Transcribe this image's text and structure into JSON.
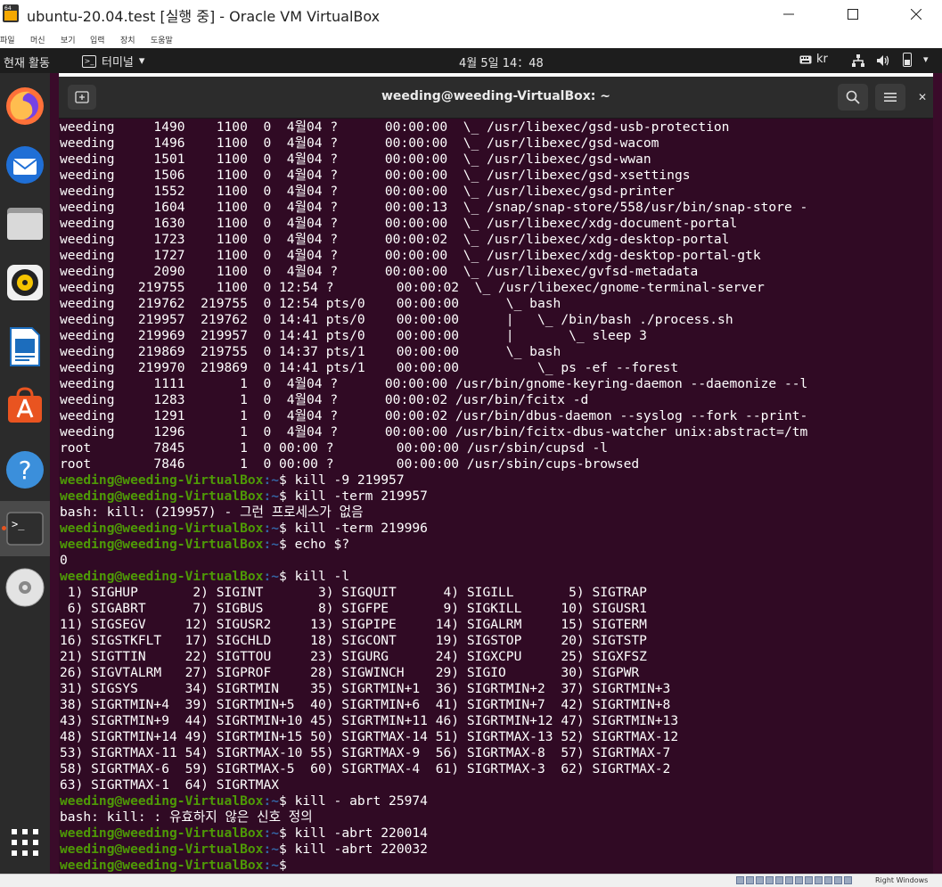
{
  "host": {
    "title": "ubuntu-20.04.test [실행 중] - Oracle VM VirtualBox",
    "menus": [
      "파일",
      "머신",
      "보기",
      "입력",
      "장치",
      "도움말"
    ],
    "host_key_label": "Right Windows"
  },
  "topbar": {
    "activities": "현재 활동",
    "app_name": "터미널",
    "clock": "4월 5일  14：48",
    "keyboard": "kr"
  },
  "dock": {
    "items": [
      "firefox-icon",
      "thunderbird-icon",
      "files-icon",
      "rhythmbox-icon",
      "writer-icon",
      "software-icon",
      "help-icon",
      "terminal-icon",
      "dvd-icon",
      "show-apps-icon"
    ]
  },
  "terminal": {
    "title": "weeding@weeding-VirtualBox: ~",
    "prompt_user": "weeding@weeding-VirtualBox",
    "prompt_path": ":~",
    "lines": [
      {
        "t": "weeding     1490    1100  0  4월04 ?      00:00:00  \\_ /usr/libexec/gsd-usb-protection"
      },
      {
        "t": "weeding     1496    1100  0  4월04 ?      00:00:00  \\_ /usr/libexec/gsd-wacom"
      },
      {
        "t": "weeding     1501    1100  0  4월04 ?      00:00:00  \\_ /usr/libexec/gsd-wwan"
      },
      {
        "t": "weeding     1506    1100  0  4월04 ?      00:00:00  \\_ /usr/libexec/gsd-xsettings"
      },
      {
        "t": "weeding     1552    1100  0  4월04 ?      00:00:00  \\_ /usr/libexec/gsd-printer"
      },
      {
        "t": "weeding     1604    1100  0  4월04 ?      00:00:13  \\_ /snap/snap-store/558/usr/bin/snap-store -"
      },
      {
        "t": "weeding     1630    1100  0  4월04 ?      00:00:00  \\_ /usr/libexec/xdg-document-portal"
      },
      {
        "t": "weeding     1723    1100  0  4월04 ?      00:00:02  \\_ /usr/libexec/xdg-desktop-portal"
      },
      {
        "t": "weeding     1727    1100  0  4월04 ?      00:00:00  \\_ /usr/libexec/xdg-desktop-portal-gtk"
      },
      {
        "t": "weeding     2090    1100  0  4월04 ?      00:00:00  \\_ /usr/libexec/gvfsd-metadata"
      },
      {
        "t": "weeding   219755    1100  0 12:54 ?        00:00:02  \\_ /usr/libexec/gnome-terminal-server"
      },
      {
        "t": "weeding   219762  219755  0 12:54 pts/0    00:00:00      \\_ bash"
      },
      {
        "t": "weeding   219957  219762  0 14:41 pts/0    00:00:00      |   \\_ /bin/bash ./process.sh"
      },
      {
        "t": "weeding   219969  219957  0 14:41 pts/0    00:00:00      |       \\_ sleep 3"
      },
      {
        "t": "weeding   219869  219755  0 14:37 pts/1    00:00:00      \\_ bash"
      },
      {
        "t": "weeding   219970  219869  0 14:41 pts/1    00:00:00          \\_ ps -ef --forest"
      },
      {
        "t": "weeding     1111       1  0  4월04 ?      00:00:00 /usr/bin/gnome-keyring-daemon --daemonize --l"
      },
      {
        "t": "weeding     1283       1  0  4월04 ?      00:00:02 /usr/bin/fcitx -d"
      },
      {
        "t": "weeding     1291       1  0  4월04 ?      00:00:02 /usr/bin/dbus-daemon --syslog --fork --print-"
      },
      {
        "t": "weeding     1296       1  0  4월04 ?      00:00:00 /usr/bin/fcitx-dbus-watcher unix:abstract=/tm"
      },
      {
        "t": "root        7845       1  0 00:00 ?        00:00:00 /usr/sbin/cupsd -l"
      },
      {
        "t": "root        7846       1  0 00:00 ?        00:00:00 /usr/sbin/cups-browsed"
      },
      {
        "cmd": "$ kill -9 219957"
      },
      {
        "cmd": "$ kill -term 219957"
      },
      {
        "t": "bash: kill: (219957) - 그런 프로세스가 없음"
      },
      {
        "cmd": "$ kill -term 219996"
      },
      {
        "cmd": "$ echo $?"
      },
      {
        "t": "0"
      },
      {
        "cmd": "$ kill -l"
      },
      {
        "t": " 1) SIGHUP       2) SIGINT       3) SIGQUIT      4) SIGILL       5) SIGTRAP"
      },
      {
        "t": " 6) SIGABRT      7) SIGBUS       8) SIGFPE       9) SIGKILL     10) SIGUSR1"
      },
      {
        "t": "11) SIGSEGV     12) SIGUSR2     13) SIGPIPE     14) SIGALRM     15) SIGTERM"
      },
      {
        "t": "16) SIGSTKFLT   17) SIGCHLD     18) SIGCONT     19) SIGSTOP     20) SIGTSTP"
      },
      {
        "t": "21) SIGTTIN     22) SIGTTOU     23) SIGURG      24) SIGXCPU     25) SIGXFSZ"
      },
      {
        "t": "26) SIGVTALRM   27) SIGPROF     28) SIGWINCH    29) SIGIO       30) SIGPWR"
      },
      {
        "t": "31) SIGSYS      34) SIGRTMIN    35) SIGRTMIN+1  36) SIGRTMIN+2  37) SIGRTMIN+3"
      },
      {
        "t": "38) SIGRTMIN+4  39) SIGRTMIN+5  40) SIGRTMIN+6  41) SIGRTMIN+7  42) SIGRTMIN+8"
      },
      {
        "t": "43) SIGRTMIN+9  44) SIGRTMIN+10 45) SIGRTMIN+11 46) SIGRTMIN+12 47) SIGRTMIN+13"
      },
      {
        "t": "48) SIGRTMIN+14 49) SIGRTMIN+15 50) SIGRTMAX-14 51) SIGRTMAX-13 52) SIGRTMAX-12"
      },
      {
        "t": "53) SIGRTMAX-11 54) SIGRTMAX-10 55) SIGRTMAX-9  56) SIGRTMAX-8  57) SIGRTMAX-7"
      },
      {
        "t": "58) SIGRTMAX-6  59) SIGRTMAX-5  60) SIGRTMAX-4  61) SIGRTMAX-3  62) SIGRTMAX-2"
      },
      {
        "t": "63) SIGRTMAX-1  64) SIGRTMAX"
      },
      {
        "cmd": "$ kill - abrt 25974"
      },
      {
        "t": "bash: kill: : 유효하지 않은 신호 정의"
      },
      {
        "cmd": "$ kill -abrt 220014"
      },
      {
        "cmd": "$ kill -abrt 220032"
      },
      {
        "cmd": "$ "
      }
    ]
  },
  "colors": {
    "terminal_bg": "#300a24",
    "prompt_user": "#4e9a06",
    "prompt_path": "#3465a4",
    "ubuntu_accent": "#e95420"
  }
}
